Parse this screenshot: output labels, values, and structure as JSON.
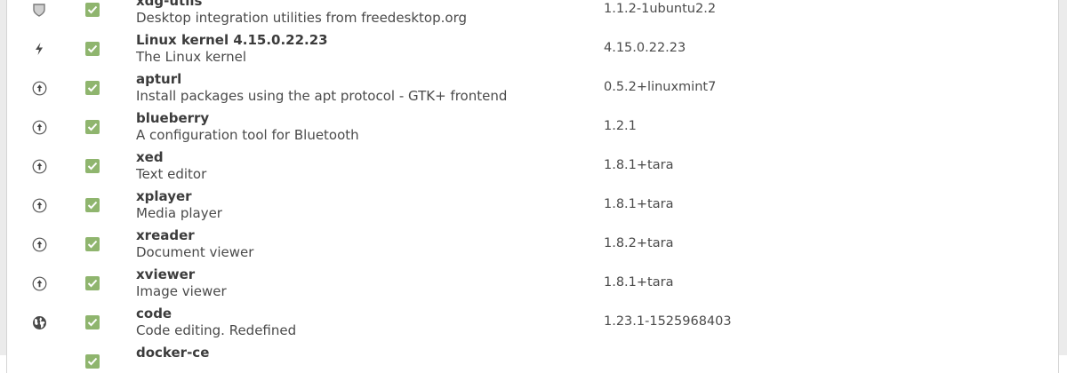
{
  "colors": {
    "checkbox": "#8fb56e",
    "text": "#3c3c3c",
    "icon": "#555555"
  },
  "updates": [
    {
      "icon": "shield-icon",
      "checked": true,
      "name": "xdg-utils",
      "description": "Desktop integration utilities from freedesktop.org",
      "version": "1.1.2-1ubuntu2.2"
    },
    {
      "icon": "lightning-icon",
      "checked": true,
      "name": "Linux kernel 4.15.0.22.23",
      "description": "The Linux kernel",
      "version": "4.15.0.22.23"
    },
    {
      "icon": "upgrade-arrow-icon",
      "checked": true,
      "name": "apturl",
      "description": "Install packages using the apt protocol - GTK+ frontend",
      "version": "0.5.2+linuxmint7"
    },
    {
      "icon": "upgrade-arrow-icon",
      "checked": true,
      "name": "blueberry",
      "description": "A configuration tool for Bluetooth",
      "version": "1.2.1"
    },
    {
      "icon": "upgrade-arrow-icon",
      "checked": true,
      "name": "xed",
      "description": "Text editor",
      "version": "1.8.1+tara"
    },
    {
      "icon": "upgrade-arrow-icon",
      "checked": true,
      "name": "xplayer",
      "description": "Media player",
      "version": "1.8.1+tara"
    },
    {
      "icon": "upgrade-arrow-icon",
      "checked": true,
      "name": "xreader",
      "description": "Document viewer",
      "version": "1.8.2+tara"
    },
    {
      "icon": "upgrade-arrow-icon",
      "checked": true,
      "name": "xviewer",
      "description": "Image viewer",
      "version": "1.8.1+tara"
    },
    {
      "icon": "globe-icon",
      "checked": true,
      "name": "code",
      "description": "Code editing. Redefined",
      "version": "1.23.1-1525968403"
    },
    {
      "icon": "",
      "checked": true,
      "name": "docker-ce",
      "description": "",
      "version": ""
    }
  ]
}
